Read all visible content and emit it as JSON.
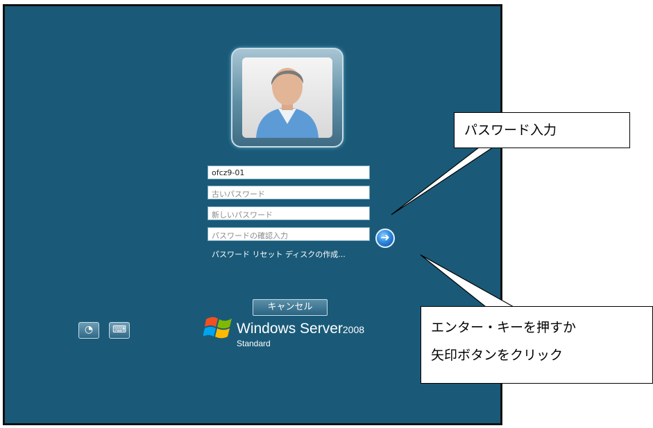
{
  "login": {
    "username": "ofcz9-01",
    "old_password_placeholder": "古いパスワード",
    "new_password_placeholder": "新しいパスワード",
    "confirm_password_placeholder": "パスワードの確認入力",
    "go_icon": "arrow-right-icon",
    "reset_link": "パスワード リセット ディスクの作成...",
    "cancel_label": "キャンセル"
  },
  "bottom": {
    "ease_of_access_icon": "ease-of-access-icon",
    "keyboard_icon": "keyboard-icon",
    "brand_name": "Windows Server",
    "brand_version": "2008",
    "brand_edition": "Standard"
  },
  "annotations": {
    "password_callout": "パスワード入力",
    "enter_callout_line1": "エンター・キーを押すか",
    "enter_callout_line2": "矢印ボタンをクリック"
  },
  "colors": {
    "background": "#1a5a78",
    "accent": "#2e8ae0"
  }
}
